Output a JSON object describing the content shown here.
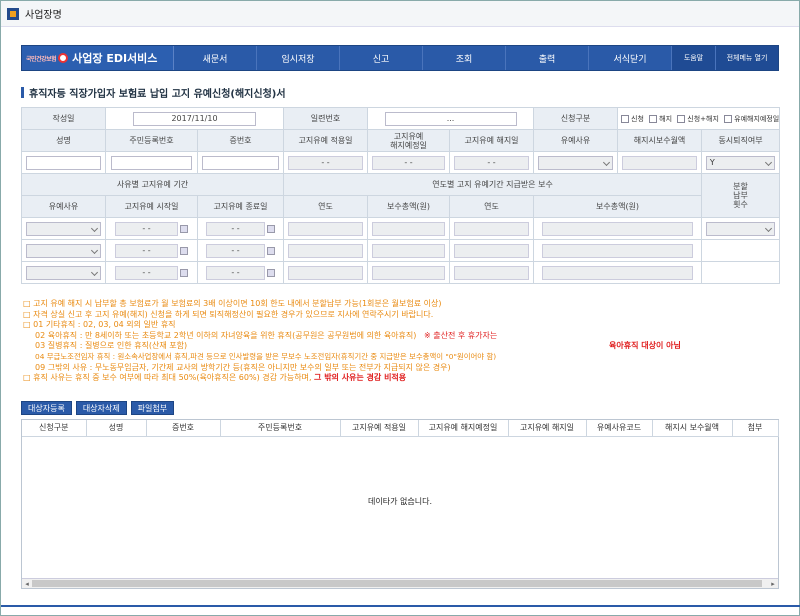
{
  "window_title": "사업장명",
  "nav": {
    "brand_mark": "국민건강보험",
    "brand": "사업장 EDI서비스",
    "items": [
      "새문서",
      "임시저장",
      "신고",
      "조회",
      "출력",
      "서식닫기"
    ],
    "help": "도움말",
    "all_menu": "전체메뉴 열기"
  },
  "page_title": "휴직자등 직장가입자 보험료 납입 고지 유예신청(해지신청)서",
  "form": {
    "date_label": "작성일",
    "date_value": "2017/11/10",
    "serial_label": "일련번호",
    "serial_value": "...",
    "apply_type_label": "신청구분",
    "apply_opts": [
      "신청",
      "해지",
      "신청+해지",
      "유예해지예정일변경"
    ],
    "head1": [
      "성명",
      "주민등록번호",
      "증번호",
      "고지유예 적용일",
      "고지유예\n해지예정일",
      "고지유예 해지일",
      "유예사유",
      "해지시보수월액",
      "동시퇴직여부"
    ],
    "date_dash": "- -",
    "y_opt": "Y",
    "sect_period": "사유별 고지유예 기간",
    "sect_pay": "연도별 고지 유예기간 지급받은 보수",
    "sect_install": "분할\n납부\n횟수",
    "head2": [
      "유예사유",
      "고지유예 시작일",
      "고지유예 종료일",
      "연도",
      "보수총액(원)",
      "연도",
      "보수총액(원)"
    ]
  },
  "notes": {
    "n1": "□ 고지 유예 해지 시 납부할 총 보험료가 월 보험료의 3배 이상이면 10회 한도 내에서 분할납부 가능(1회분은 월보험료 이상)",
    "n2": "□ 자격 상실 신고 후 고지 유예(해지) 신청을 하게 되면 퇴직해정산이 필요한 경우가 있으므로 지사에 연락주시기 바랍니다.",
    "n3": "□ 01 기타휴직 : 02, 03, 04 외의 일반 휴직",
    "n4": "02 육아휴직 : 만 8세이하 또는 초등학교 2학년 이하의 자녀양육을 위한 휴직(공무원은 공무원법에 의한 육아휴직)",
    "n4b": "※ 출산전 후 휴가자는",
    "n5": "03 질병휴직 : 질병으로 인한 휴직(산재 포함)",
    "n5b": "육아휴직 대상이 아님",
    "n6": "04 무급노조전임자 휴직 : 원소속사업장에서 휴직,파견 등으로 인사발령을 받은 무보수 노조전임자(휴직기간 중 지급받은 보수총액이 \"0\"원이어야 함)",
    "n7": "09 그밖의 사유 : 무노동무임금자, 기간제 교사의 방학기간 등(휴직은 아니지만 보수의 일부 또는 전부가 지급되지 않은 경우)",
    "n8": "□ 휴직 사유는 휴직 중 보수 여부에 따라 최대 50%(육아휴직은 60%) 경감 가능하며,",
    "n8b": "그 밖의 사유는 경감 비적용"
  },
  "buttons": [
    "대상자등록",
    "대상자삭제",
    "파일첨부"
  ],
  "grid": {
    "headers": [
      "신청구분",
      "성명",
      "증번호",
      "주민등록번호",
      "고지유예 적용일",
      "고지유예 해지예정일",
      "고지유예 해지일",
      "유예사유코드",
      "해지시 보수월액",
      "첨부"
    ],
    "empty": "데이타가 없습니다."
  },
  "colors": {
    "nav": "#2a5aa8",
    "note": "#e98a10",
    "warn": "#e02020"
  }
}
